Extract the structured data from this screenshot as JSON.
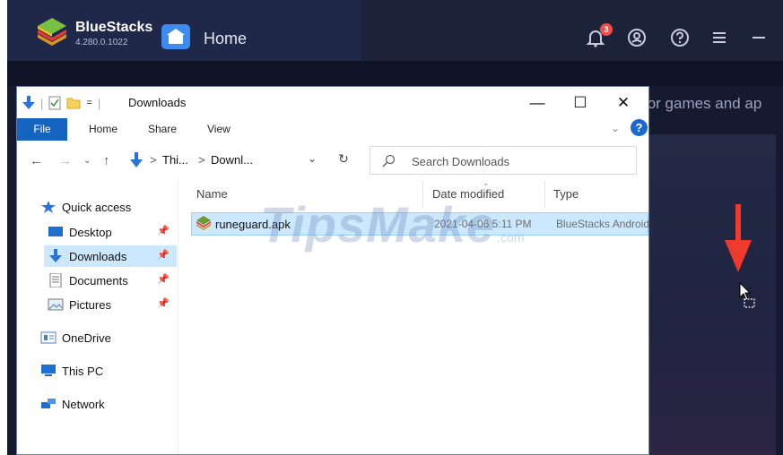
{
  "bluestacks": {
    "app_name": "BlueStacks",
    "version": "4.280.0.1022",
    "home_label": "Home",
    "notification_count": "3",
    "search_hint": "for games and ap",
    "colors": {
      "accent": "#3d8bef",
      "arrow": "#f03a2e",
      "badge": "#f24d4d"
    }
  },
  "explorer": {
    "title": "Downloads",
    "qat_sep": "=",
    "ribbon": {
      "file": "File",
      "home": "Home",
      "share": "Share",
      "view": "View",
      "help": "?"
    },
    "address": {
      "segments": [
        "Thi...",
        "Downl..."
      ],
      "sep": ">"
    },
    "search_placeholder": "Search Downloads",
    "nav": {
      "quick_access": "Quick access",
      "items": [
        {
          "label": "Desktop",
          "icon": "desktop-icon",
          "pinned": true
        },
        {
          "label": "Downloads",
          "icon": "downloads-icon",
          "pinned": true,
          "selected": true
        },
        {
          "label": "Documents",
          "icon": "documents-icon",
          "pinned": true
        },
        {
          "label": "Pictures",
          "icon": "pictures-icon",
          "pinned": true
        }
      ],
      "onedrive": "OneDrive",
      "this_pc": "This PC",
      "network": "Network"
    },
    "columns": {
      "name": "Name",
      "date": "Date modified",
      "type": "Type"
    },
    "files": [
      {
        "name": "runeguard.apk",
        "date": "2021-04-06 5:11 PM",
        "type": "BlueStacks Android"
      }
    ]
  },
  "watermark": {
    "text": "TipsMake",
    "suffix": ".com"
  }
}
